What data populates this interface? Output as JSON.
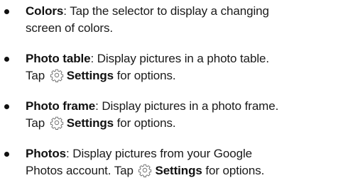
{
  "items": [
    {
      "term": "Colors",
      "line1": ": Tap the selector to display a changing",
      "line2": "screen of colors."
    },
    {
      "term": "Photo table",
      "line1": ": Display pictures in a photo table.",
      "tap": "Tap",
      "settings": "Settings",
      "rest": "for options."
    },
    {
      "term": "Photo frame",
      "line1": ": Display pictures in a photo frame.",
      "tap": "Tap",
      "settings": "Settings",
      "rest": "for options."
    },
    {
      "term": "Photos",
      "line1": ": Display pictures from your Google",
      "line2": "Photos account. Tap",
      "settings": "Settings",
      "rest": "for options."
    }
  ],
  "icons": {
    "settings": "gear-icon"
  }
}
